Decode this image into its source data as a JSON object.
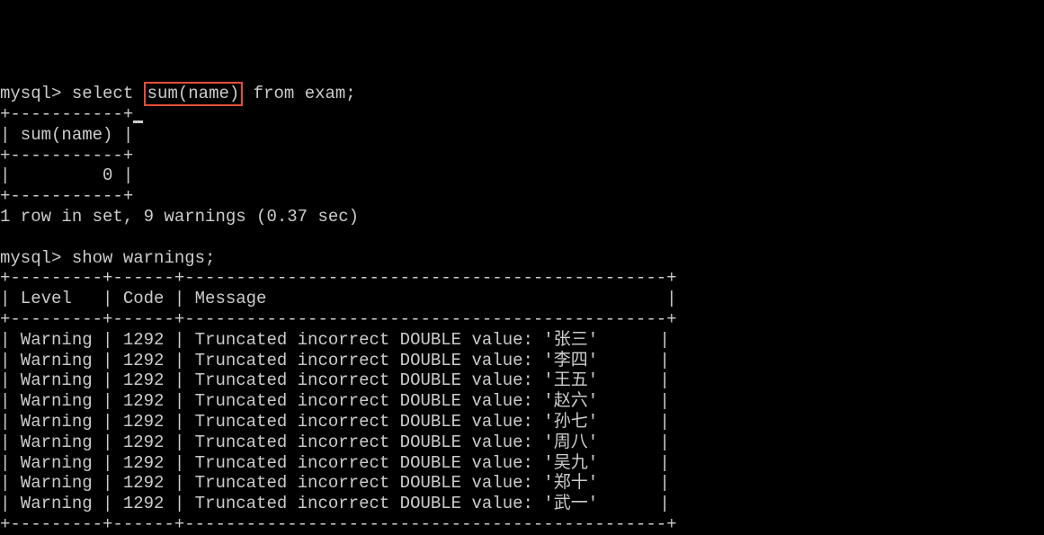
{
  "prompt1": "mysql> ",
  "query1_pre": "select ",
  "query1_highlight": "sum(name)",
  "query1_post": " from exam;",
  "table1_border_top": "+-----------+",
  "table1_header": "| sum(name) |",
  "table1_border_mid": "+-----------+",
  "table1_row": "|         0 |",
  "table1_border_bot": "+-----------+",
  "result1_status": "1 row in set, 9 warnings (0.37 sec)",
  "prompt2": "mysql> ",
  "query2": "show warnings;",
  "table2_border": "+---------+------+-----------------------------------------------+",
  "table2_header": "| Level   | Code | Message                                       |",
  "warnings": [
    "| Warning | 1292 | Truncated incorrect DOUBLE value: '张三'      |",
    "| Warning | 1292 | Truncated incorrect DOUBLE value: '李四'      |",
    "| Warning | 1292 | Truncated incorrect DOUBLE value: '王五'      |",
    "| Warning | 1292 | Truncated incorrect DOUBLE value: '赵六'      |",
    "| Warning | 1292 | Truncated incorrect DOUBLE value: '孙七'      |",
    "| Warning | 1292 | Truncated incorrect DOUBLE value: '周八'      |",
    "| Warning | 1292 | Truncated incorrect DOUBLE value: '吴九'      |",
    "| Warning | 1292 | Truncated incorrect DOUBLE value: '郑十'      |",
    "| Warning | 1292 | Truncated incorrect DOUBLE value: '武一'      |"
  ]
}
